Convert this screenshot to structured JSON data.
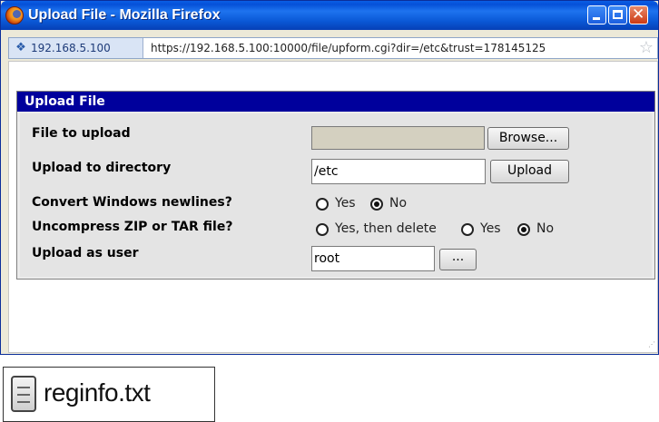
{
  "window": {
    "title": "Upload File - Mozilla Firefox",
    "controls": {
      "minimize": "minimize",
      "maximize": "maximize",
      "close": "✕"
    }
  },
  "urlbar": {
    "site_host": "192.168.5.100",
    "url": "https://192.168.5.100:10000/file/upform.cgi?dir=/etc&trust=178145125"
  },
  "form": {
    "title": "Upload File",
    "file_to_upload": {
      "label": "File to upload",
      "value": "",
      "browse_label": "Browse..."
    },
    "upload_dir": {
      "label": "Upload to directory",
      "value": "/etc",
      "upload_label": "Upload"
    },
    "convert_newlines": {
      "label": "Convert Windows newlines?",
      "options": [
        "Yes",
        "No"
      ],
      "selected": "No"
    },
    "uncompress": {
      "label": "Uncompress ZIP or TAR file?",
      "options": [
        "Yes, then delete",
        "Yes",
        "No"
      ],
      "selected": "No"
    },
    "upload_user": {
      "label": "Upload as user",
      "value": "root",
      "picker_label": "..."
    }
  },
  "file_icon": {
    "name": "reginfo.txt"
  },
  "colors": {
    "titlebar": "#0a58d6",
    "panel_header": "#00009c",
    "panel_body": "#e4e4e4"
  }
}
